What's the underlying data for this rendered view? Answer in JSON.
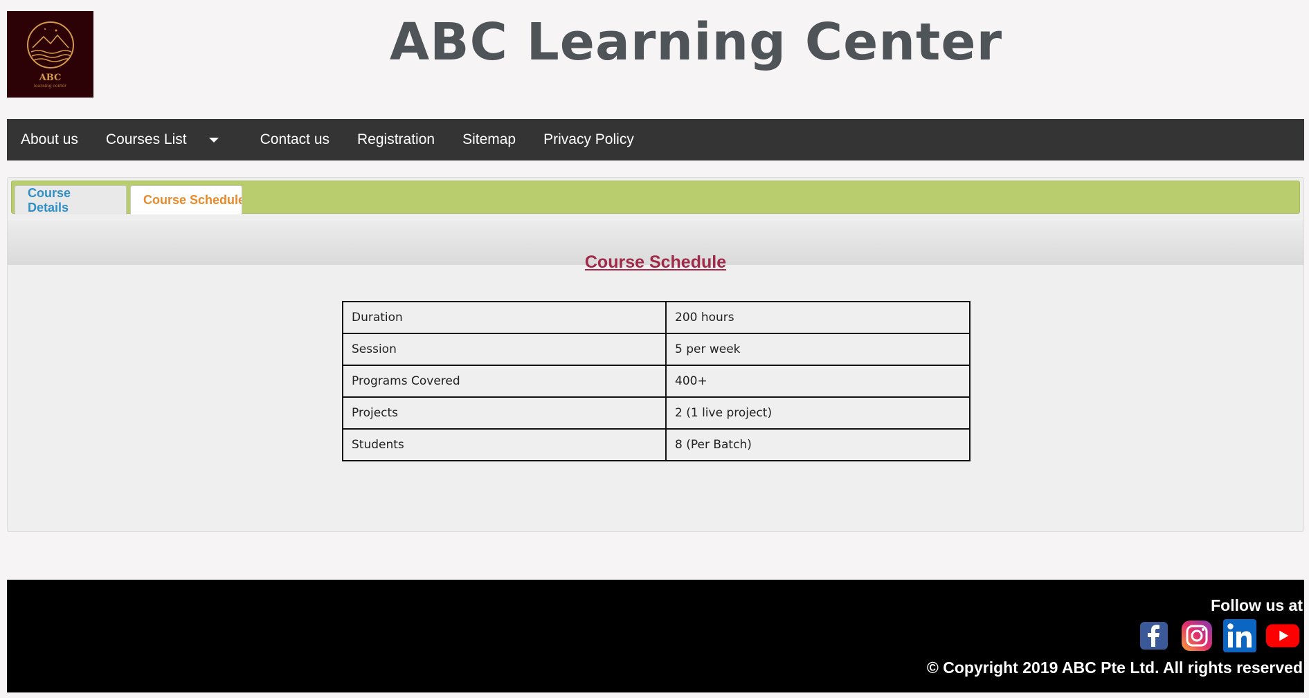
{
  "header": {
    "logo_text": "ABC",
    "logo_subtext": "learning center",
    "title": "ABC Learning Center"
  },
  "nav": {
    "items": [
      {
        "label": "About us"
      },
      {
        "label": "Courses List",
        "icon": "caret-down-icon"
      },
      {
        "label": "Contact us"
      },
      {
        "label": "Registration"
      },
      {
        "label": "Sitemap"
      },
      {
        "label": "Privacy Policy"
      }
    ]
  },
  "tabs": [
    {
      "label": "Course Details",
      "active": false,
      "color": "#2f8fc4"
    },
    {
      "label": "Course Schedule",
      "active": true,
      "color": "#e8892a"
    }
  ],
  "schedule": {
    "heading": "Course Schedule",
    "rows": [
      {
        "label": "Duration",
        "value": "200 hours"
      },
      {
        "label": "Session",
        "value": "5 per week"
      },
      {
        "label": "Programs Covered",
        "value": "400+"
      },
      {
        "label": "Projects",
        "value": "2 (1 live project)"
      },
      {
        "label": "Students",
        "value": "8 (Per Batch)"
      }
    ]
  },
  "footer": {
    "follow_text": "Follow us at",
    "socials": [
      {
        "name": "facebook-icon",
        "color": "#3b5998"
      },
      {
        "name": "instagram-icon",
        "color": "#c13584"
      },
      {
        "name": "linkedin-icon",
        "color": "#0a66c2"
      },
      {
        "name": "youtube-icon",
        "color": "#ff0000"
      }
    ],
    "copyright": "© Copyright 2019 ABC Pte Ltd. All rights reserved"
  },
  "colors": {
    "navbar": "#343434",
    "tabbar": "#b9cd6f",
    "heading": "#a02a4a",
    "title": "#4f5459"
  }
}
